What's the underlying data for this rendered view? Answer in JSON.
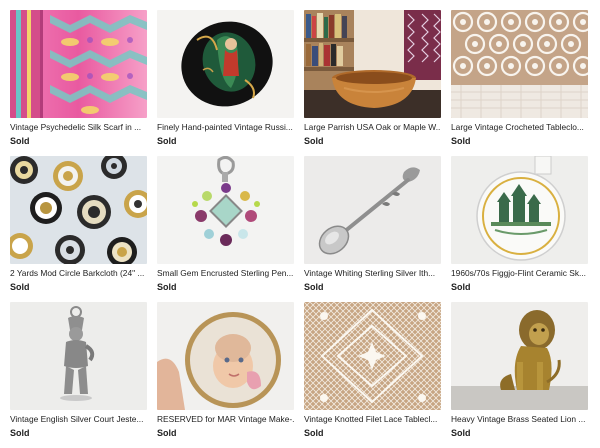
{
  "listings": [
    {
      "title": "Vintage Psychedelic Silk Scarf in ...",
      "status": "Sold",
      "image": "psychedelic-silk-scarf-photo"
    },
    {
      "title": "Finely Hand-painted Vintage Russi...",
      "status": "Sold",
      "image": "hand-painted-brooch-photo"
    },
    {
      "title": "Large Parrish USA Oak or Maple W...",
      "status": "Sold",
      "image": "wooden-bowl-photo"
    },
    {
      "title": "Large Vintage Crocheted Tableclo...",
      "status": "Sold",
      "image": "crocheted-tablecloth-photo"
    },
    {
      "title": "2 Yards Mod Circle Barkcloth (24\" ...",
      "status": "Sold",
      "image": "mod-circle-barkcloth-photo"
    },
    {
      "title": "Small Gem Encrusted Sterling Pen...",
      "status": "Sold",
      "image": "gem-sterling-pendant-photo"
    },
    {
      "title": "Vintage Whiting Sterling Silver Ith...",
      "status": "Sold",
      "image": "sterling-silver-spoon-photo"
    },
    {
      "title": "1960s/70s Figgjo-Flint Ceramic Sk...",
      "status": "Sold",
      "image": "figgjo-ceramic-dish-photo"
    },
    {
      "title": "Vintage English Silver Court Jeste...",
      "status": "Sold",
      "image": "silver-court-jester-photo"
    },
    {
      "title": "RESERVED for MAR Vintage Make-...",
      "status": "Sold",
      "image": "vintage-compact-photo"
    },
    {
      "title": "Vintage Knotted Filet Lace Tablecl...",
      "status": "Sold",
      "image": "filet-lace-tablecloth-photo"
    },
    {
      "title": "Heavy Vintage Brass Seated Lion ...",
      "status": "Sold",
      "image": "brass-lion-photo"
    }
  ]
}
